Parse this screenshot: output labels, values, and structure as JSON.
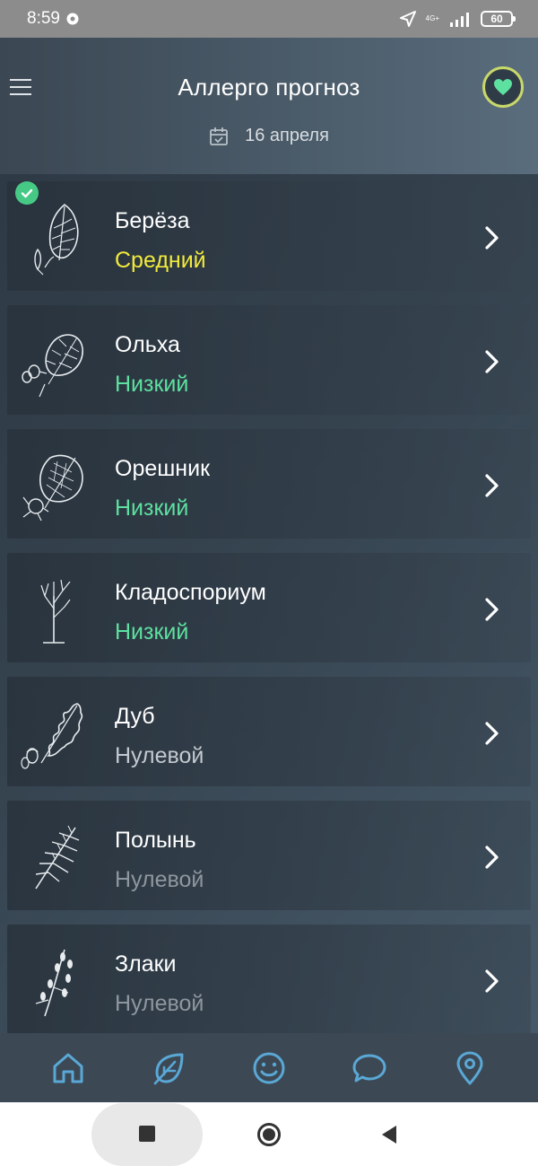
{
  "status_bar": {
    "time": "8:59",
    "network": "4G+",
    "battery": "60"
  },
  "header": {
    "title": "Аллерго прогноз",
    "date": "16 апреля"
  },
  "colors": {
    "level_medium": "#f2ea3c",
    "level_low": "#5ee0a0",
    "level_zero_bright": "#c3c9cf",
    "level_zero_dim": "#8e979f",
    "accent_nav": "#5aa8d6",
    "fav_ring": "#c9d86a",
    "fav_heart": "#5ee0a0",
    "check_badge": "#47c986"
  },
  "allergens": [
    {
      "name": "Берёза",
      "level": "Средний",
      "icon": "birch-leaf-icon",
      "selected": true
    },
    {
      "name": "Ольха",
      "level": "Низкий",
      "icon": "alder-leaf-icon"
    },
    {
      "name": "Орешник",
      "level": "Низкий",
      "icon": "hazel-leaf-icon"
    },
    {
      "name": "Кладоспориум",
      "level": "Низкий",
      "icon": "cladosporium-icon"
    },
    {
      "name": "Дуб",
      "level": "Нулевой",
      "icon": "oak-leaf-icon"
    },
    {
      "name": "Полынь",
      "level": "Нулевой",
      "icon": "wormwood-icon"
    },
    {
      "name": "Злаки",
      "level": "Нулевой",
      "icon": "grass-icon"
    }
  ],
  "bottom_nav": [
    {
      "id": "home",
      "icon": "home-icon"
    },
    {
      "id": "plants",
      "icon": "leaf-icon"
    },
    {
      "id": "diary",
      "icon": "smiley-icon"
    },
    {
      "id": "chat",
      "icon": "chat-bubble-icon"
    },
    {
      "id": "map",
      "icon": "location-pin-icon"
    }
  ]
}
